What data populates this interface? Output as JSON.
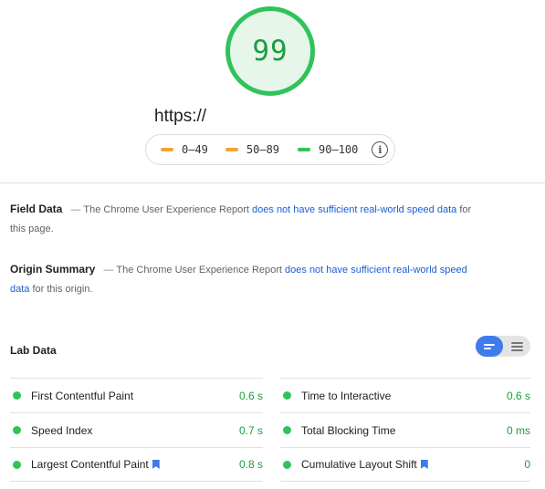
{
  "score": "99",
  "url": "https://",
  "legend": {
    "items": [
      {
        "label": "0–49",
        "color": "#f4a23b"
      },
      {
        "label": "50–89",
        "color": "#f4a23b"
      },
      {
        "label": "90–100",
        "color": "#2fc35a"
      }
    ],
    "info_icon": "info-icon"
  },
  "field_data": {
    "heading": "Field Data",
    "separator": "—",
    "text_before": "The Chrome User Experience Report",
    "link": "does not have sufficient real-world speed data",
    "text_after": "for this page."
  },
  "origin_summary": {
    "heading": "Origin Summary",
    "separator": "—",
    "text_before": "The Chrome User Experience Report",
    "link": "does not have sufficient real-world speed data",
    "text_after": "for this origin."
  },
  "lab_data": {
    "heading": "Lab Data",
    "toggle": {
      "active": "compact-view",
      "inactive": "expanded-view"
    },
    "metrics_left": [
      {
        "name": "First Contentful Paint",
        "value": "0.6 s",
        "bookmark": false
      },
      {
        "name": "Speed Index",
        "value": "0.7 s",
        "bookmark": false
      },
      {
        "name": "Largest Contentful Paint",
        "value": "0.8 s",
        "bookmark": true
      }
    ],
    "metrics_right": [
      {
        "name": "Time to Interactive",
        "value": "0.6 s",
        "bookmark": false
      },
      {
        "name": "Total Blocking Time",
        "value": "0 ms",
        "bookmark": false
      },
      {
        "name": "Cumulative Layout Shift",
        "value": "0",
        "bookmark": true
      }
    ]
  },
  "colors": {
    "pass": "#2fc35a",
    "pass_text": "#1a9e3c",
    "average": "#f4a23b",
    "link": "#1a5ed6",
    "accent": "#3f7bea"
  }
}
